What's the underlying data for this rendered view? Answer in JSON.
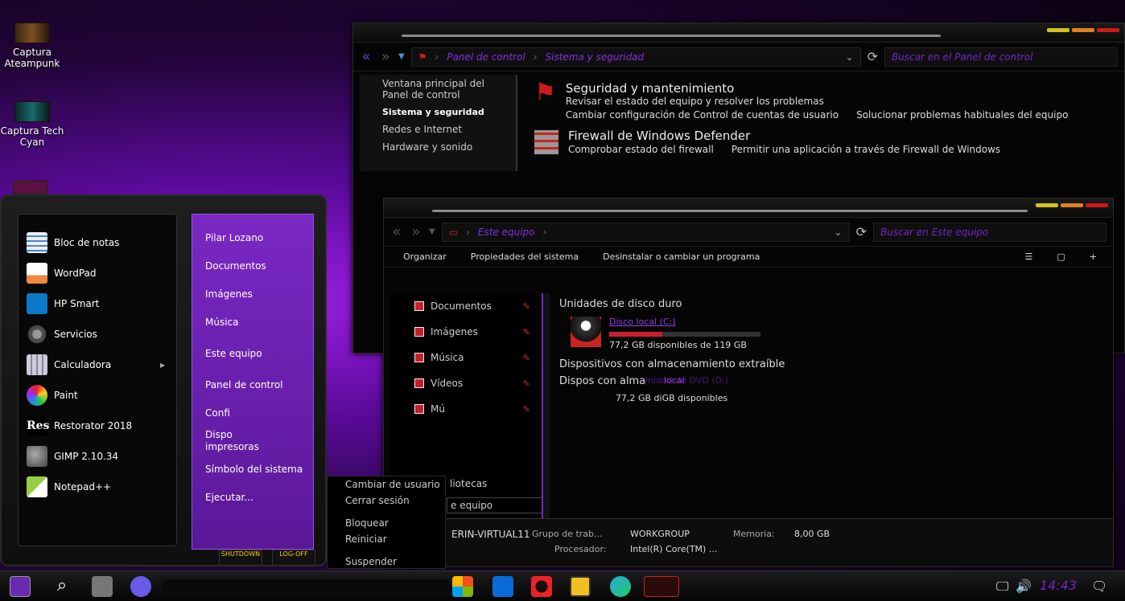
{
  "desktop": {
    "icons": [
      {
        "label": "Captura Ateampunk"
      },
      {
        "label": "Captura Tech Cyan"
      }
    ]
  },
  "control_panel": {
    "address": {
      "crumb1": "Panel de control",
      "crumb2": "Sistema y seguridad",
      "search_placeholder": "Buscar en el Panel de control"
    },
    "sidebar": [
      "Ventana principal del Panel de control",
      "Sistema y seguridad",
      "Redes e Internet",
      "Hardware y sonido"
    ],
    "sections": [
      {
        "title": "Seguridad y mantenimiento",
        "desc": "Revisar el estado del equipo y resolver los problemas",
        "links": [
          "Cambiar configuración de Control de cuentas de usuario",
          "Solucionar problemas habituales del equipo"
        ]
      },
      {
        "title": "Firewall de Windows Defender",
        "desc": "",
        "links": [
          "Comprobar estado del firewall",
          "Permitir una aplicación a través de Firewall de Windows"
        ]
      }
    ]
  },
  "explorer": {
    "address": {
      "crumb": "Este equipo",
      "search_placeholder": "Buscar en Este equipo"
    },
    "toolbar": {
      "organize": "Organizar",
      "props": "Propiedades del sistema",
      "uninstall": "Desinstalar o cambiar un programa"
    },
    "nav": [
      "Documentos",
      "Imágenes",
      "Música",
      "Vídeos",
      "Mú"
    ],
    "nav_bottom": [
      "liotecas",
      "e equipo"
    ],
    "groups": {
      "hdd": "Unidades de disco duro",
      "removable": "Dispositivos con almacenamiento extraíble",
      "overlap": "Dispos con alma"
    },
    "drive_c": {
      "name": "Disco local (C:)",
      "space": "77,2 GB disponibles de 119 GB",
      "fill": 0.35
    },
    "drive_dvd": {
      "name": "Unidad de DVD (D:)",
      "name2": "local",
      "space": "77,2 GB diGB disponibles"
    },
    "details": {
      "pc": "ERIN-VIRTUAL11",
      "group_label": "Grupo de trab...",
      "group": "WORKGROUP",
      "mem_label": "Memoria:",
      "mem": "8,00 GB",
      "cpu_label": "Procesador:",
      "cpu": "Intel(R) Core(TM) ..."
    }
  },
  "start_menu": {
    "apps": [
      "Bloc de notas",
      "WordPad",
      "HP Smart",
      "Servicios",
      "Calculadora",
      "Paint",
      "Restorator 2018",
      "GIMP 2.10.34",
      "Notepad++"
    ],
    "places": [
      "Pilar Lozano",
      "Documentos",
      "Imágenes",
      "Música",
      "Este equipo",
      "Panel de control",
      "Confi",
      "Dispo",
      "impresoras",
      "Símbolo del sistema",
      "Ejecutar..."
    ],
    "shutdown": "SHUTDOWN",
    "logoff": "LOG-OFF"
  },
  "power_menu": [
    "Cambiar de usuario",
    "Cerrar sesión",
    "Bloquear",
    "Reiniciar",
    "Suspender"
  ],
  "taskbar": {
    "clock": "14:43"
  }
}
